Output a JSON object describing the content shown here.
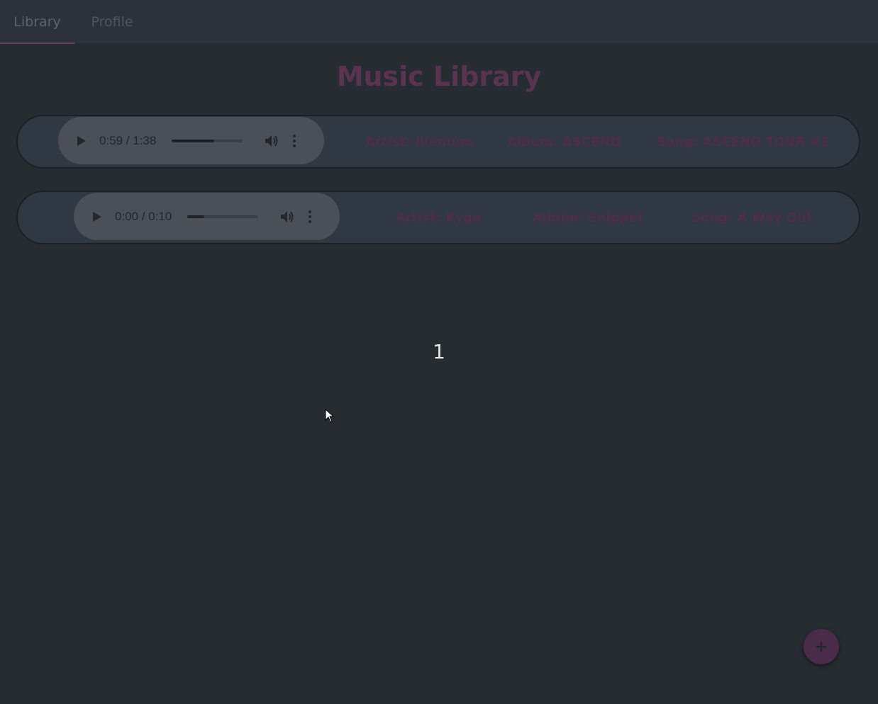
{
  "tabs": [
    {
      "label": "Library",
      "active": true
    },
    {
      "label": "Profile",
      "active": false
    }
  ],
  "page_title": "Music Library",
  "songs": [
    {
      "player": {
        "time": "0:59 / 1:38",
        "progress": 0.6
      },
      "artist": "Artist: Illenium",
      "album": "Album: ASCEND",
      "song": "Song: ASCEND TOUR #3"
    },
    {
      "player": {
        "time": "0:00 / 0:10",
        "progress": 0.24
      },
      "artist": "Artist: Kygo",
      "album": "Album: Snippet",
      "song": "Song: A Way Out"
    }
  ],
  "pagination": {
    "current_page": "1"
  },
  "fab": {
    "label": "+",
    "icon": "plus-icon"
  },
  "colors": {
    "background": "#272c33",
    "accent": "#6b3d5e",
    "title": "#5a3350",
    "card": "#303842"
  }
}
